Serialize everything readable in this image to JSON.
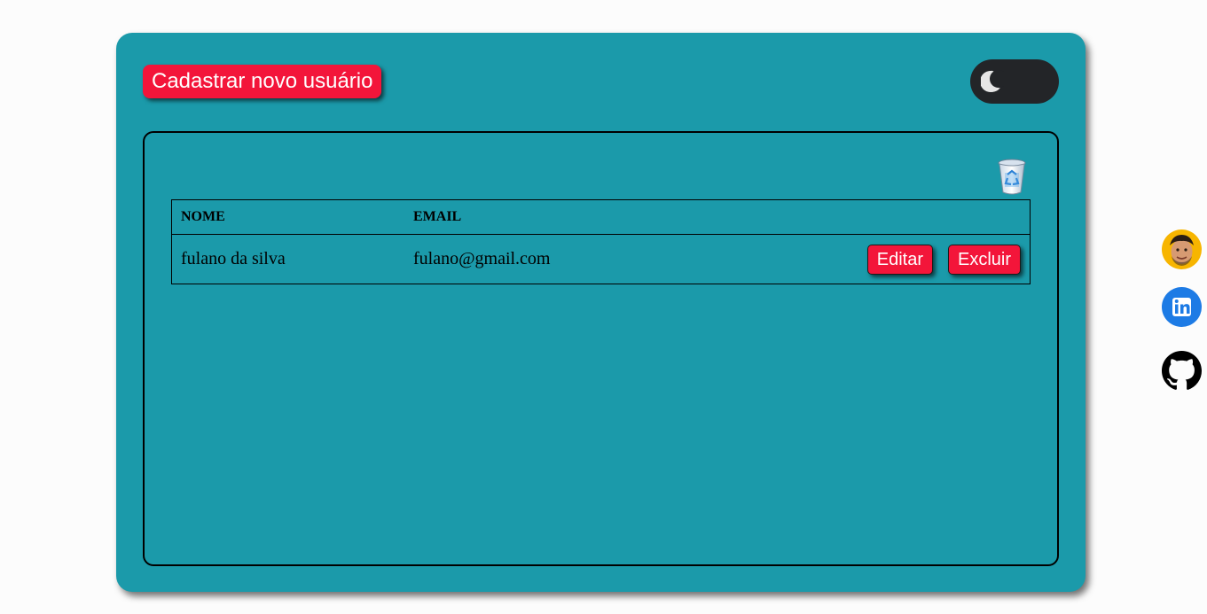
{
  "header": {
    "new_user_label": "Cadastrar novo usuário"
  },
  "theme_toggle": {
    "icon": "moon-icon",
    "mode": "dark"
  },
  "table": {
    "trash_icon": "trash-bin-icon",
    "columns": [
      "NOME",
      "EMAIL",
      ""
    ],
    "rows": [
      {
        "name": "fulano da silva",
        "email": "fulano@gmail.com",
        "edit_label": "Editar",
        "delete_label": "Excluir"
      }
    ]
  },
  "social_links": [
    {
      "icon": "avatar-icon"
    },
    {
      "icon": "linkedin-icon"
    },
    {
      "icon": "github-icon"
    }
  ],
  "colors": {
    "page_background": "#fcfcfc",
    "card_background": "#1b9aaa",
    "accent_red": "#f3153a",
    "toggle_background": "#232528",
    "linkedin_blue": "#1d7be5"
  }
}
